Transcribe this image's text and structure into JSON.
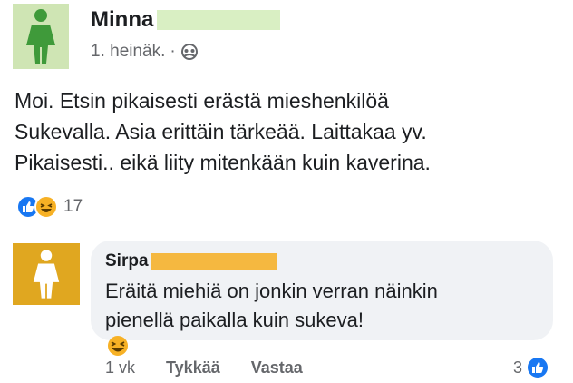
{
  "post": {
    "author": "Minna",
    "timestamp": "1. heinäk.",
    "separator": "·",
    "privacy_icon": "friends-icon",
    "body_lines": [
      "Moi. Etsin pikaisesti erästä mieshenkilöä",
      "Sukevalla.  Asia erittäin tärkeää. Laittakaa yv.",
      "Pikaisesti.. eikä liity mitenkään kuin kaverina."
    ],
    "reaction_count": "17",
    "reaction_icons": [
      "like-icon",
      "haha-icon"
    ]
  },
  "comment": {
    "author": "Sirpa",
    "text_lines": [
      "Eräitä miehiä on jonkin verran näinkin",
      "pienellä paikalla kuin suke­va!"
    ],
    "age": "1 vk",
    "like_label": "Tykkää",
    "reply_label": "Vastaa",
    "reaction_count": "3",
    "emoji": "haha-emoji"
  },
  "colors": {
    "post_avatar_bg": "#cfe5b4",
    "post_avatar_figure": "#3f9a3a",
    "comment_avatar_bg": "#e0a720",
    "comment_avatar_figure": "#ffffff",
    "like_blue": "#1877f2",
    "haha_yellow": "#f7b125"
  }
}
